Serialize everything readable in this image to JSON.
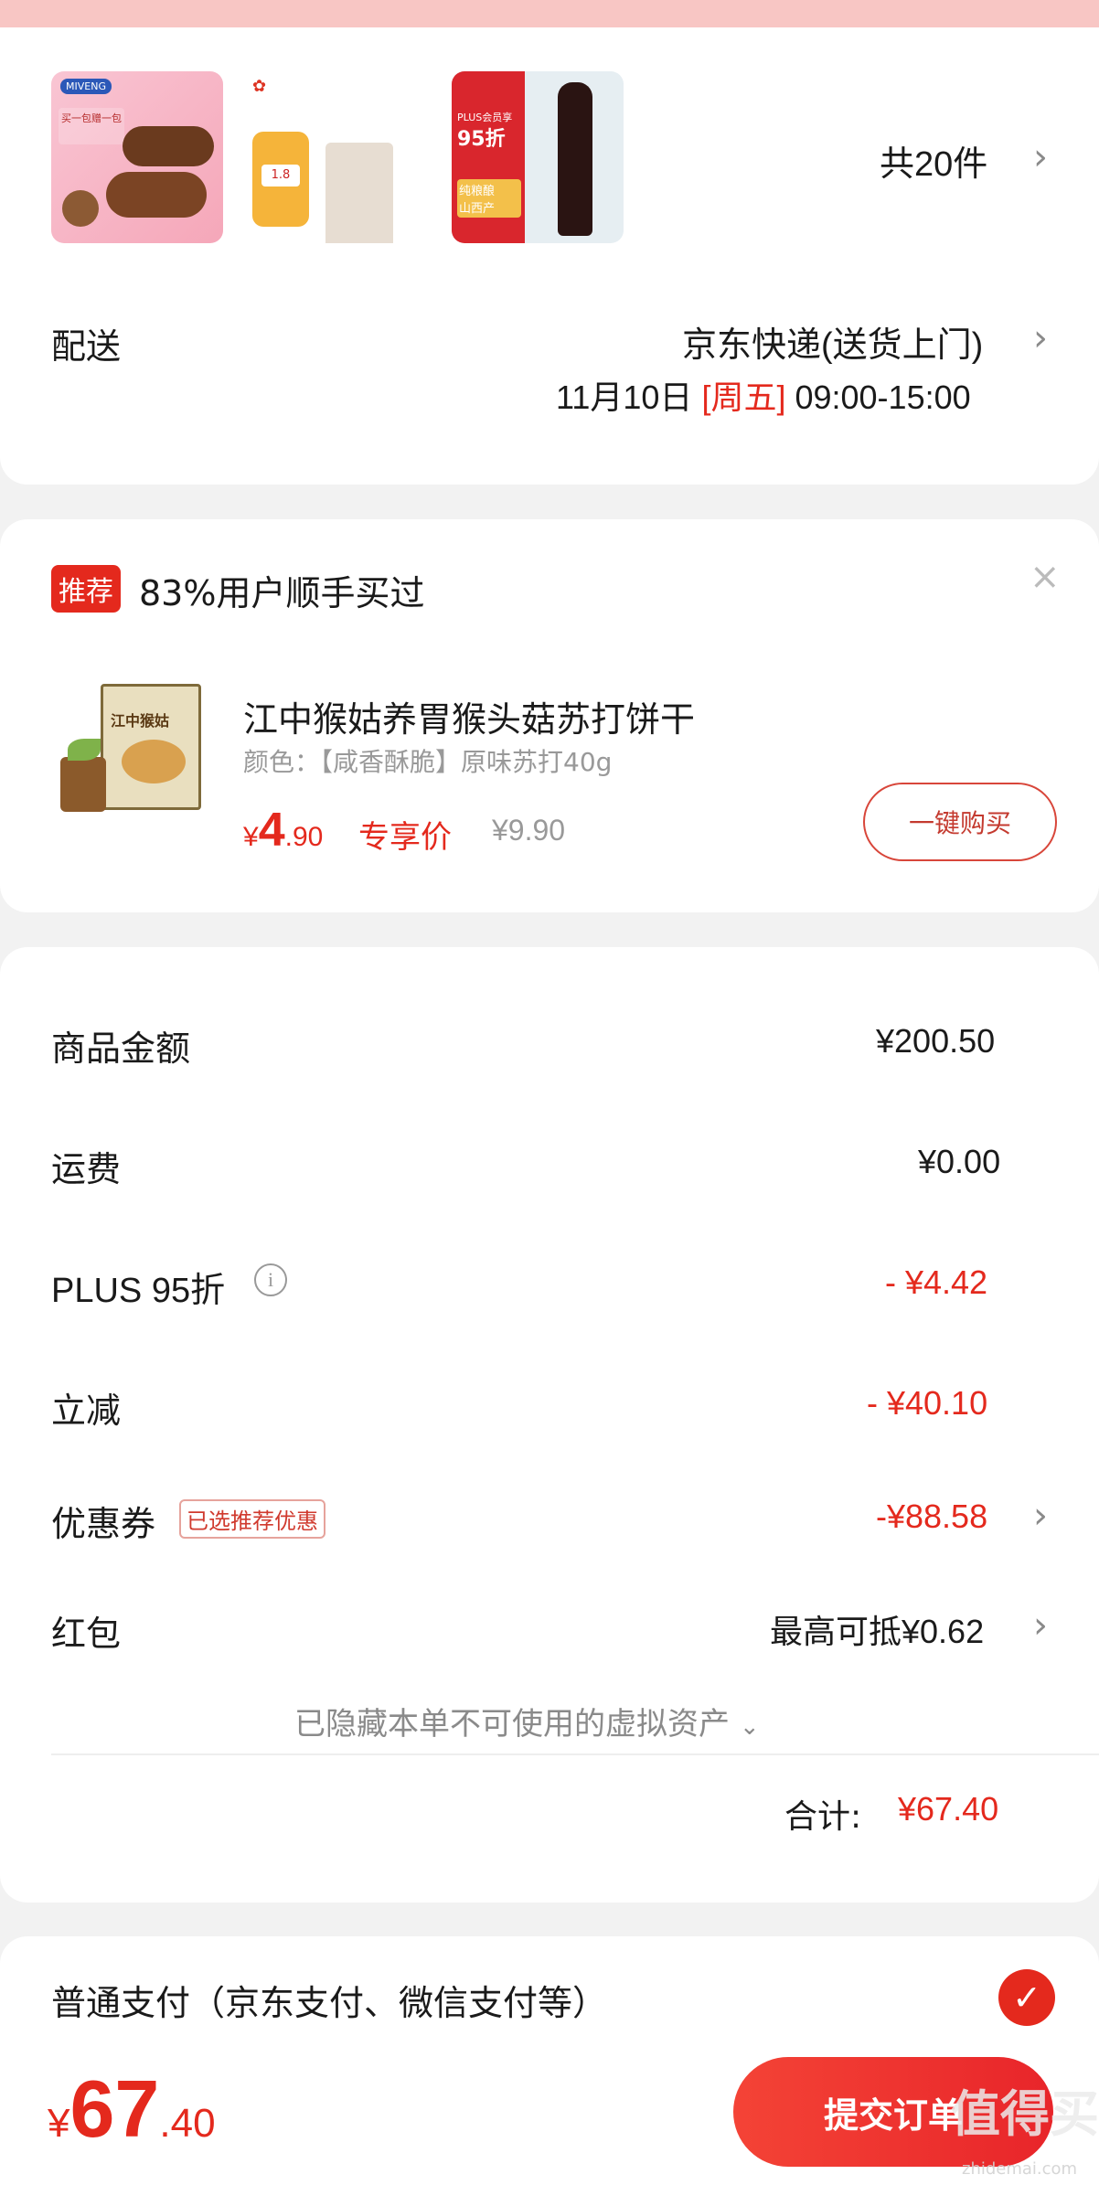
{
  "order": {
    "item_count": "共20件",
    "shipping_label": "配送",
    "shipping_method": "京东快递(送货上门)",
    "shipping_date": "11月10日",
    "shipping_weekday": "[周五]",
    "shipping_time": "09:00-15:00"
  },
  "thumbs": [
    {
      "name": "product-thumb-cake",
      "text": "买一包赠一包"
    },
    {
      "name": "product-thumb-snack",
      "text": "1.8"
    },
    {
      "name": "product-thumb-soysauce",
      "text": "95折"
    }
  ],
  "thumb_text": {
    "t1_brand": "MIVENG",
    "t2_price": "1.8",
    "t3_badge": "95折",
    "t3_sub": "纯粮酿\n山西产",
    "t3_top": "PLUS会员享"
  },
  "recommend": {
    "tag": "推荐",
    "title": "83%用户顺手买过",
    "product_name": "江中猴姑养胃猴头菇苏打饼干",
    "product_spec": "颜色：【咸香酥脆】原味苏打40g",
    "price_symbol": "¥",
    "price_int": "4",
    "price_dec": ".90",
    "price_label": "专享价",
    "original_price": "¥9.90",
    "buy_button": "一键购买",
    "box_text": "江中猴姑"
  },
  "summary": {
    "rows": [
      {
        "label": "商品金额",
        "value": "¥200.50"
      },
      {
        "label": "运费",
        "value": "¥0.00"
      },
      {
        "label": "PLUS 95折",
        "value": "- ¥4.42"
      },
      {
        "label": "立减",
        "value": "- ¥40.10"
      },
      {
        "label": "优惠券",
        "tag": "已选推荐优惠",
        "value": "-¥88.58"
      },
      {
        "label": "红包",
        "value": "最高可抵¥0.62"
      }
    ],
    "hidden_assets": "已隐藏本单不可使用的虚拟资产",
    "total_label": "合计:",
    "total_value": "¥67.40"
  },
  "payment": {
    "method": "普通支付（京东支付、微信支付等）"
  },
  "bottom_bar": {
    "currency": "¥",
    "amount_int": "67",
    "amount_dec": ".40",
    "submit": "提交订单",
    "watermark": "值得买",
    "watermark_sub": "zhidemai.com"
  },
  "colors": {
    "accent": "#e4291d",
    "submit_gradient_start": "#f44336",
    "submit_gradient_end": "#e8252a",
    "top_band": "#f8c6c4"
  }
}
